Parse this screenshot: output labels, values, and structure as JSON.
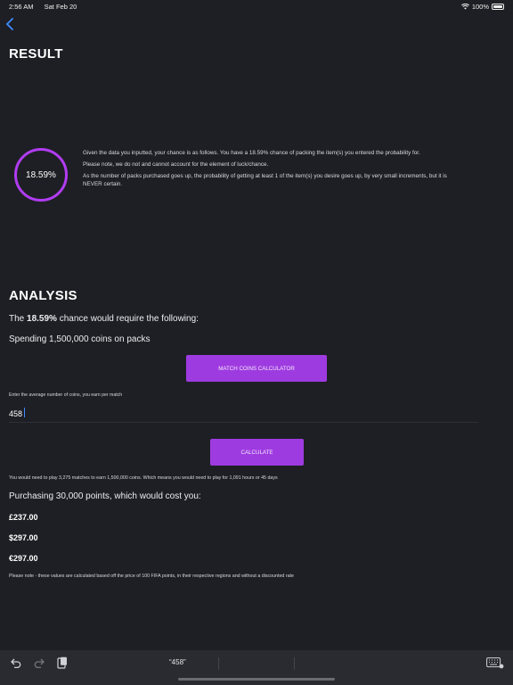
{
  "status_bar": {
    "time": "2:56 AM",
    "date": "Sat Feb 20",
    "battery": "100%"
  },
  "result": {
    "title": "RESULT",
    "percentage": "18.59%",
    "paragraph1": "Given the data you inputted, your chance is as follows. You have a 18.59% chance of packing the item(s) you entered the probability for.",
    "paragraph2": "Please note, we do not and cannot account for the element of luck/chance.",
    "paragraph3": "As the number of packs purchased goes up, the probability of getting at least 1 of the item(s) you desire goes up, by very small increments, but it is NEVER certain."
  },
  "analysis": {
    "title": "ANALYSIS",
    "chance_prefix": "The ",
    "chance_value": "18.59%",
    "chance_suffix": " chance would require the following:",
    "spending": "Spending 1,500,000 coins on packs",
    "match_button": "MATCH COINS CALCULATOR",
    "input_label": "Enter the average number of coins, you earn per match",
    "input_value": "458",
    "calculate_button": "CALCULATE",
    "matches_note": "You would need to play 3,275 matches to earn 1,500,000 coins. Which means you would need to play for 1,091 hours or 45 days",
    "points_text": "Purchasing 30,000 points, which would cost you:",
    "prices": [
      "£237.00",
      "$297.00",
      "€297.00"
    ],
    "disclaimer": "Please note - these values are calculated based off the price of 100 FIFA points, in their respective regions and without a discounted rate"
  },
  "keyboard_bar": {
    "suggestion": "“458”"
  },
  "colors": {
    "accent": "#9e3be0",
    "ring": "#b13cf2",
    "background": "#1e1f24",
    "link": "#3d8cff"
  }
}
